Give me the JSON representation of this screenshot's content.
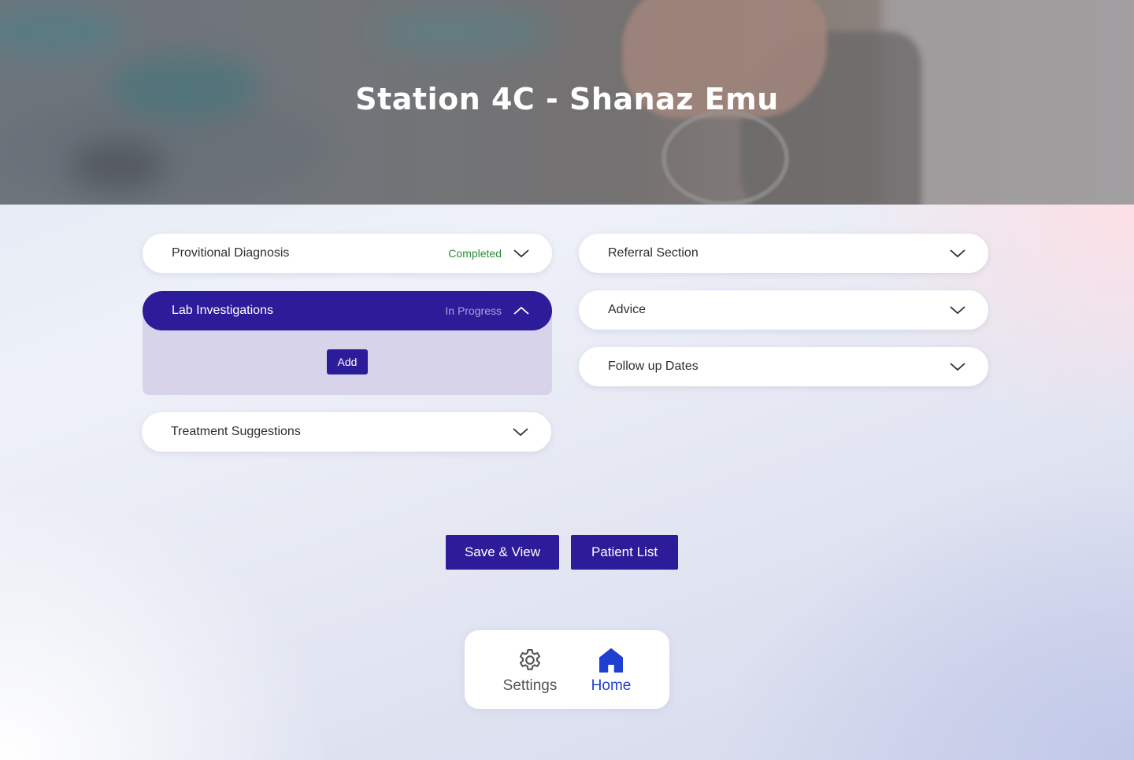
{
  "header": {
    "title": "Station 4C - Shanaz Emu"
  },
  "sections": {
    "provisional_diagnosis": {
      "label": "Provitional Diagnosis",
      "status": "Completed"
    },
    "lab_investigations": {
      "label": "Lab Investigations",
      "status": "In Progress",
      "add_label": "Add"
    },
    "treatment_suggestions": {
      "label": "Treatment Suggestions"
    },
    "referral_section": {
      "label": "Referral Section"
    },
    "advice": {
      "label": "Advice"
    },
    "follow_up_dates": {
      "label": "Follow up Dates"
    }
  },
  "actions": {
    "save_view": "Save & View",
    "patient_list": "Patient List"
  },
  "nav": {
    "settings": {
      "label": "Settings",
      "icon": "gear-icon"
    },
    "home": {
      "label": "Home",
      "icon": "home-icon",
      "active": true
    }
  },
  "colors": {
    "primary": "#2d1c9a",
    "completed": "#2e8a3a",
    "in_progress": "#a9a2d8",
    "nav_active": "#1f3fd0",
    "nav_inactive": "#555555"
  }
}
